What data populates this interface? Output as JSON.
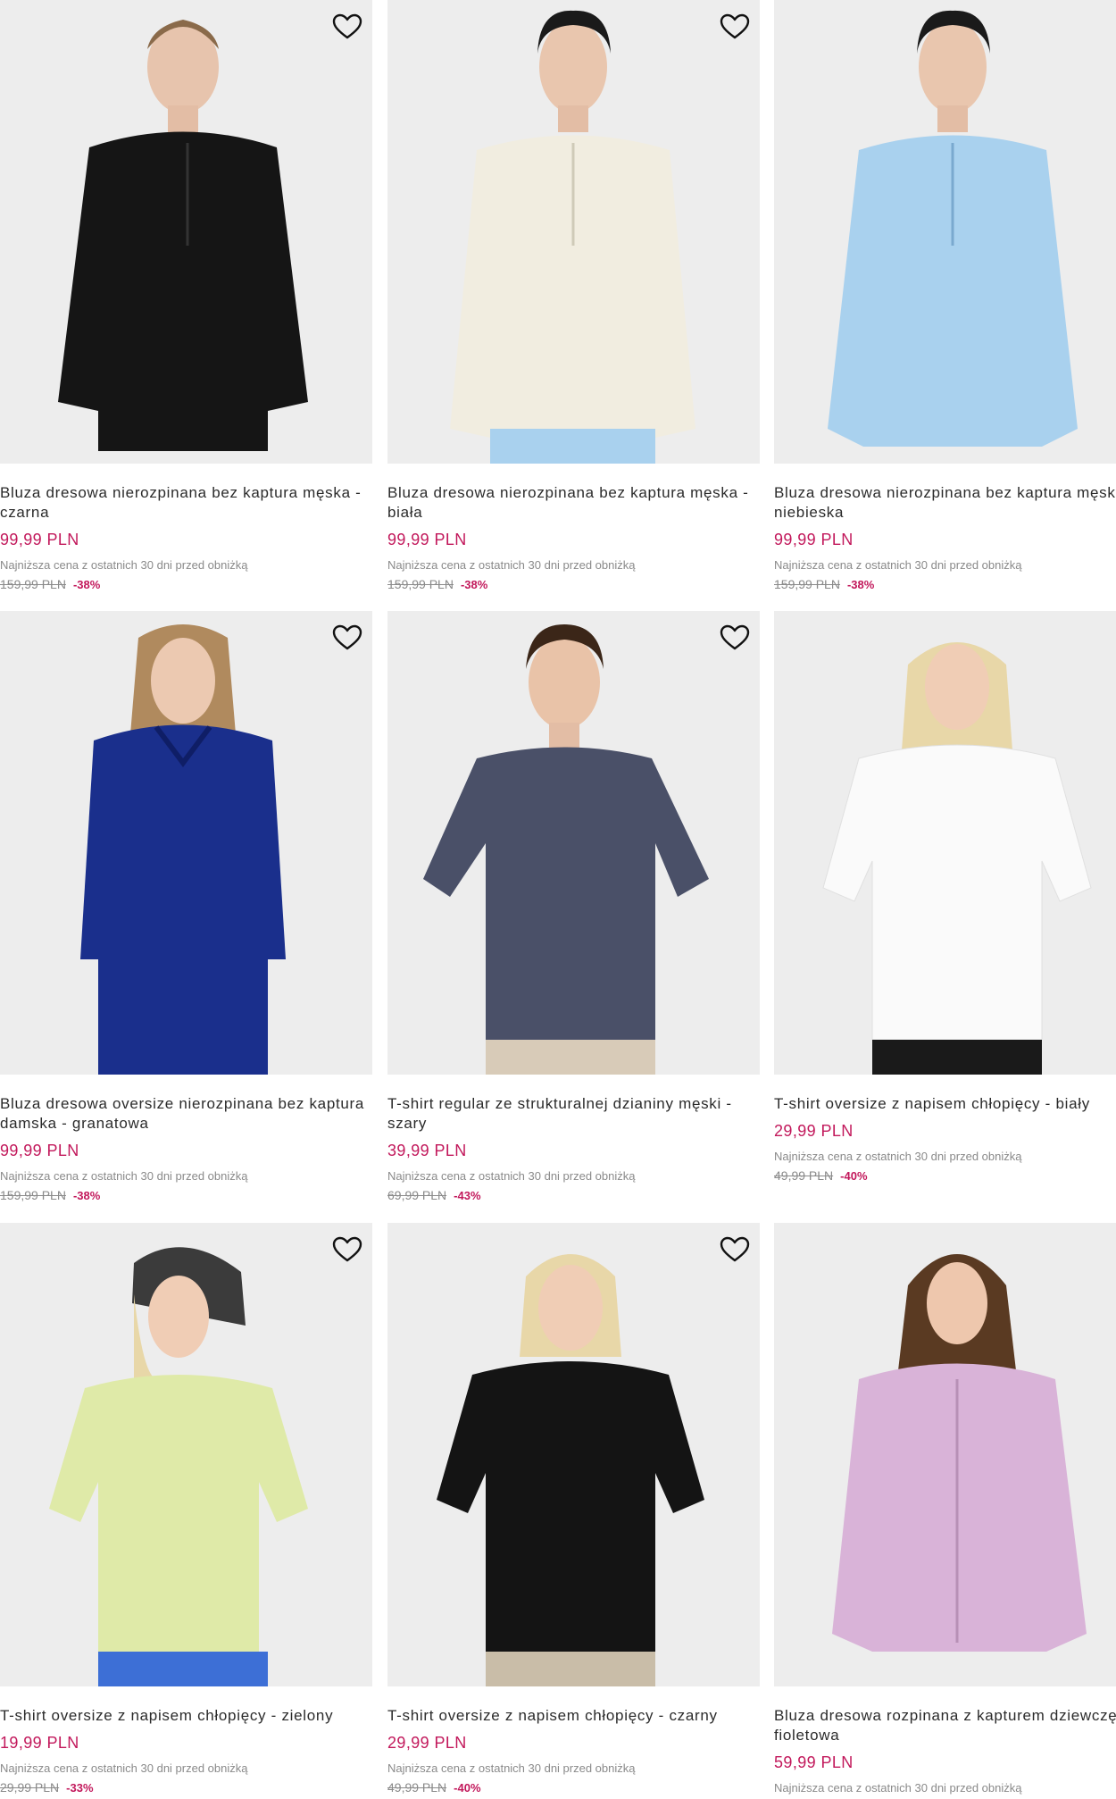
{
  "currency_colors": {
    "price": "#c2185b",
    "muted": "#8a8a8a"
  },
  "lowest_label": "Najniższa cena z ostatnich 30 dni przed obniżką",
  "products": [
    {
      "name": "Bluza dresowa nierozpinana bez kaptura męska - czarna",
      "price": "99,99 PLN",
      "old_price": "159,99 PLN",
      "discount": "-38%",
      "garment_color": "#151515",
      "icon": "heart-icon"
    },
    {
      "name": "Bluza dresowa nierozpinana bez kaptura męska - biała",
      "price": "99,99 PLN",
      "old_price": "159,99 PLN",
      "discount": "-38%",
      "garment_color": "#f1ede0",
      "icon": "heart-icon"
    },
    {
      "name": "Bluza dresowa nierozpinana bez kaptura męska - niebieska",
      "price": "99,99 PLN",
      "old_price": "159,99 PLN",
      "discount": "-38%",
      "garment_color": "#a9d1ee",
      "icon": "heart-icon"
    },
    {
      "name": "Bluza dresowa oversize nierozpinana bez kaptura damska - granatowa",
      "price": "99,99 PLN",
      "old_price": "159,99 PLN",
      "discount": "-38%",
      "garment_color": "#1a2f8c",
      "icon": "heart-icon"
    },
    {
      "name": "T-shirt regular ze strukturalnej dzianiny męski - szary",
      "price": "39,99 PLN",
      "old_price": "69,99 PLN",
      "discount": "-43%",
      "garment_color": "#4a5068",
      "icon": "heart-icon"
    },
    {
      "name": "T-shirt oversize z napisem chłopięcy - biały",
      "price": "29,99 PLN",
      "old_price": "49,99 PLN",
      "discount": "-40%",
      "garment_color": "#fafafa",
      "icon": "heart-icon"
    },
    {
      "name": "T-shirt oversize z napisem chłopięcy - zielony",
      "price": "19,99 PLN",
      "old_price": "29,99 PLN",
      "discount": "-33%",
      "garment_color": "#dfeaa8",
      "icon": "heart-icon"
    },
    {
      "name": "T-shirt oversize z napisem chłopięcy - czarny",
      "price": "29,99 PLN",
      "old_price": "49,99 PLN",
      "discount": "-40%",
      "garment_color": "#141414",
      "icon": "heart-icon"
    },
    {
      "name": "Bluza dresowa rozpinana z kapturem dziewczęca - fioletowa",
      "price": "59,99 PLN",
      "old_price": "",
      "discount": "",
      "garment_color": "#d9b3d8",
      "icon": "heart-icon"
    }
  ]
}
